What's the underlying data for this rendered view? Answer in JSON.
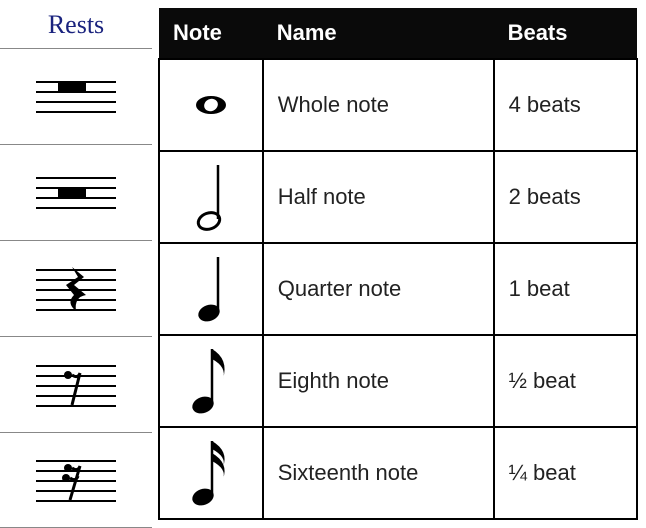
{
  "rests": {
    "title": "Rests",
    "items": [
      {
        "id": "whole-rest"
      },
      {
        "id": "half-rest"
      },
      {
        "id": "quarter-rest"
      },
      {
        "id": "eighth-rest"
      },
      {
        "id": "sixteenth-rest"
      }
    ]
  },
  "table": {
    "headers": {
      "note": "Note",
      "name": "Name",
      "beats": "Beats"
    },
    "rows": [
      {
        "id": "whole-note",
        "name": "Whole note",
        "beats": "4 beats"
      },
      {
        "id": "half-note",
        "name": "Half note",
        "beats": "2 beats"
      },
      {
        "id": "quarter-note",
        "name": "Quarter note",
        "beats": "1 beat"
      },
      {
        "id": "eighth-note",
        "name": "Eighth note",
        "beats": "½ beat"
      },
      {
        "id": "sixteenth-note",
        "name": "Sixteenth note",
        "beats": "¼ beat"
      }
    ]
  },
  "chart_data": {
    "type": "table",
    "title": "Music note values",
    "columns": [
      "Note",
      "Name",
      "Beats"
    ],
    "rows": [
      [
        "Whole note symbol",
        "Whole note",
        "4 beats"
      ],
      [
        "Half note symbol",
        "Half note",
        "2 beats"
      ],
      [
        "Quarter note symbol",
        "Quarter note",
        "1 beat"
      ],
      [
        "Eighth note symbol",
        "Eighth note",
        "½ beat"
      ],
      [
        "Sixteenth note symbol",
        "Sixteenth note",
        "¼ beat"
      ]
    ],
    "sidebar": {
      "title": "Rests",
      "items": [
        "Whole rest",
        "Half rest",
        "Quarter rest",
        "Eighth rest",
        "Sixteenth rest"
      ]
    }
  }
}
